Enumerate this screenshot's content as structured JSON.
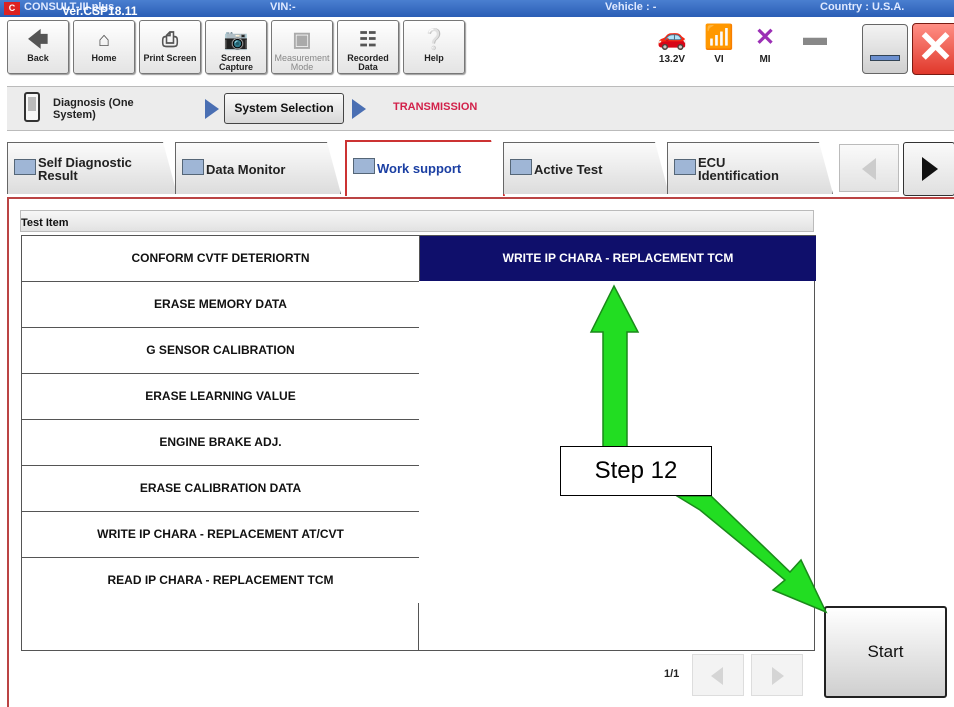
{
  "titlebar": {
    "app_name": "CONSULT-III plus",
    "version": "Ver.CSP18.11",
    "vin": "VIN:-",
    "vehicle": "Vehicle : -",
    "country": "Country : U.S.A."
  },
  "toolbar": {
    "back": "Back",
    "home": "Home",
    "print_screen": "Print Screen",
    "screen_capture": "Screen Capture",
    "measurement_mode": "Measurement Mode",
    "recorded_data": "Recorded Data",
    "help": "Help",
    "voltage": "13.2V",
    "vi": "VI",
    "mi": "MI"
  },
  "breadcrumb": {
    "diagnosis": "Diagnosis (One System)",
    "system_selection": "System Selection",
    "current": "TRANSMISSION"
  },
  "tabs": [
    {
      "label": "Self Diagnostic Result"
    },
    {
      "label": "Data Monitor"
    },
    {
      "label": "Work support"
    },
    {
      "label": "Active Test"
    },
    {
      "label": "ECU Identification"
    }
  ],
  "test_list": {
    "header": "Test Item",
    "left_items": [
      "CONFORM CVTF DETERIORTN",
      "ERASE MEMORY DATA",
      "G SENSOR CALIBRATION",
      "ERASE LEARNING VALUE",
      "ENGINE BRAKE ADJ.",
      "ERASE CALIBRATION DATA",
      "WRITE IP CHARA - REPLACEMENT AT/CVT",
      "READ IP CHARA - REPLACEMENT TCM"
    ],
    "right_items": [
      "WRITE IP CHARA - REPLACEMENT TCM"
    ],
    "page_indicator": "1/1"
  },
  "start_button": "Start",
  "annotation": {
    "step_label": "Step 12",
    "arrow_color": "#22dd22"
  },
  "colors": {
    "selected_row": "#0f0f6b",
    "accent_red": "#d2214a",
    "active_tab_border": "#cc3333"
  }
}
